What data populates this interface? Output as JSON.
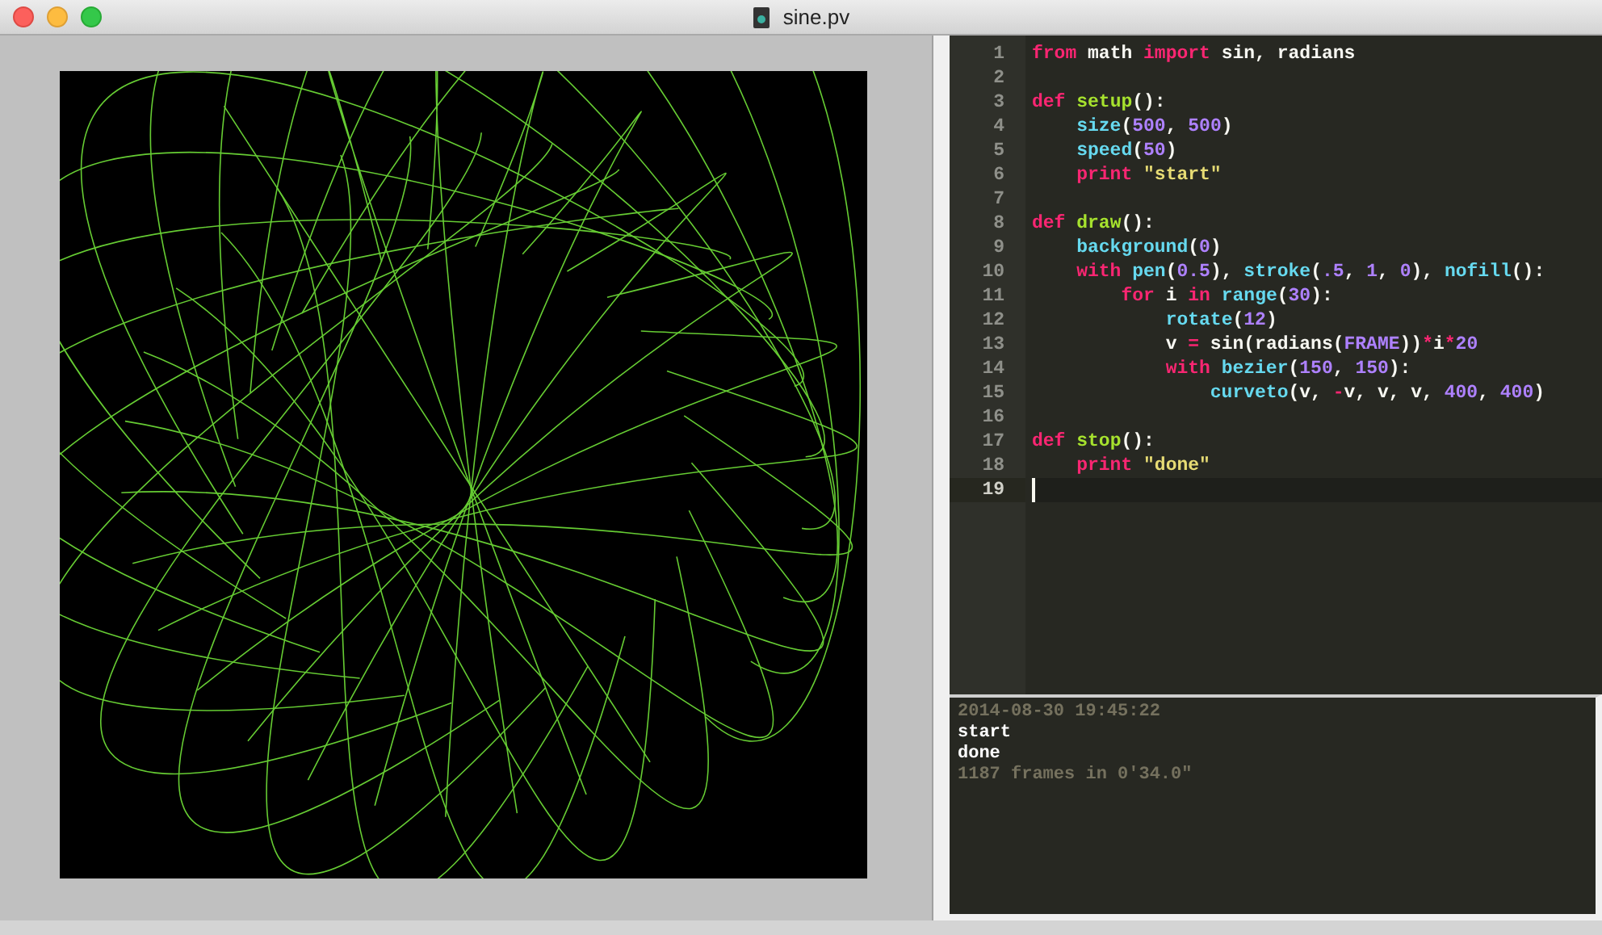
{
  "window": {
    "title": "sine.pv"
  },
  "editor": {
    "lines": [
      {
        "number": "1",
        "current": false,
        "tokens": [
          {
            "kind": "keyword",
            "text": "from"
          },
          {
            "kind": "plain",
            "text": " math "
          },
          {
            "kind": "keyword",
            "text": "import"
          },
          {
            "kind": "plain",
            "text": " sin, radians"
          }
        ]
      },
      {
        "number": "2",
        "current": false
      },
      {
        "number": "3",
        "current": false,
        "tokens": [
          {
            "kind": "keyword",
            "text": "def "
          },
          {
            "kind": "definition",
            "text": "setup"
          },
          {
            "kind": "plain",
            "text": "():"
          }
        ],
        "children": [
          {
            "number": "4",
            "current": false,
            "tokens": [
              {
                "kind": "function",
                "text": "size"
              },
              {
                "kind": "plain",
                "text": "("
              },
              {
                "kind": "number",
                "text": "500"
              },
              {
                "kind": "plain",
                "text": ", "
              },
              {
                "kind": "number",
                "text": "500"
              },
              {
                "kind": "plain",
                "text": ")"
              }
            ]
          },
          {
            "number": "5",
            "current": false,
            "tokens": [
              {
                "kind": "function",
                "text": "speed"
              },
              {
                "kind": "plain",
                "text": "("
              },
              {
                "kind": "number",
                "text": "50"
              },
              {
                "kind": "plain",
                "text": ")"
              }
            ]
          },
          {
            "number": "6",
            "current": false,
            "tokens": [
              {
                "kind": "keyword",
                "text": "print "
              },
              {
                "kind": "string",
                "text": "\"start\""
              }
            ]
          }
        ]
      },
      {
        "number": "7",
        "current": false
      },
      {
        "number": "8",
        "current": false,
        "tokens": [
          {
            "kind": "keyword",
            "text": "def "
          },
          {
            "kind": "definition",
            "text": "draw"
          },
          {
            "kind": "plain",
            "text": "():"
          }
        ],
        "children": [
          {
            "number": "9",
            "current": false,
            "tokens": [
              {
                "kind": "function",
                "text": "background"
              },
              {
                "kind": "plain",
                "text": "("
              },
              {
                "kind": "number",
                "text": "0"
              },
              {
                "kind": "plain",
                "text": ")"
              }
            ]
          },
          {
            "number": "10",
            "current": false,
            "tokens": [
              {
                "kind": "keyword",
                "text": "with "
              },
              {
                "kind": "function",
                "text": "pen"
              },
              {
                "kind": "plain",
                "text": "("
              },
              {
                "kind": "number",
                "text": "0.5"
              },
              {
                "kind": "plain",
                "text": "), "
              },
              {
                "kind": "function",
                "text": "stroke"
              },
              {
                "kind": "plain",
                "text": "("
              },
              {
                "kind": "number",
                "text": ".5"
              },
              {
                "kind": "plain",
                "text": ", "
              },
              {
                "kind": "number",
                "text": "1"
              },
              {
                "kind": "plain",
                "text": ", "
              },
              {
                "kind": "number",
                "text": "0"
              },
              {
                "kind": "plain",
                "text": "), "
              },
              {
                "kind": "function",
                "text": "nofill"
              },
              {
                "kind": "plain",
                "text": "():"
              }
            ],
            "children": [
              {
                "number": "11",
                "current": false,
                "tokens": [
                  {
                    "kind": "keyword",
                    "text": "for"
                  },
                  {
                    "kind": "plain",
                    "text": " i "
                  },
                  {
                    "kind": "keyword",
                    "text": "in "
                  },
                  {
                    "kind": "function",
                    "text": "range"
                  },
                  {
                    "kind": "plain",
                    "text": "("
                  },
                  {
                    "kind": "number",
                    "text": "30"
                  },
                  {
                    "kind": "plain",
                    "text": "):"
                  }
                ],
                "children": [
                  {
                    "number": "12",
                    "current": false,
                    "tokens": [
                      {
                        "kind": "function",
                        "text": "rotate"
                      },
                      {
                        "kind": "plain",
                        "text": "("
                      },
                      {
                        "kind": "number",
                        "text": "12"
                      },
                      {
                        "kind": "plain",
                        "text": ")"
                      }
                    ]
                  },
                  {
                    "number": "13",
                    "current": false,
                    "tokens": [
                      {
                        "kind": "plain",
                        "text": "v "
                      },
                      {
                        "kind": "keyword",
                        "text": "="
                      },
                      {
                        "kind": "plain",
                        "text": " sin(radians("
                      },
                      {
                        "kind": "number",
                        "text": "FRAME"
                      },
                      {
                        "kind": "plain",
                        "text": "))"
                      },
                      {
                        "kind": "keyword",
                        "text": "*"
                      },
                      {
                        "kind": "plain",
                        "text": "i"
                      },
                      {
                        "kind": "keyword",
                        "text": "*"
                      },
                      {
                        "kind": "number",
                        "text": "20"
                      }
                    ]
                  },
                  {
                    "number": "14",
                    "current": false,
                    "tokens": [
                      {
                        "kind": "keyword",
                        "text": "with "
                      },
                      {
                        "kind": "function",
                        "text": "bezier"
                      },
                      {
                        "kind": "plain",
                        "text": "("
                      },
                      {
                        "kind": "number",
                        "text": "150"
                      },
                      {
                        "kind": "plain",
                        "text": ", "
                      },
                      {
                        "kind": "number",
                        "text": "150"
                      },
                      {
                        "kind": "plain",
                        "text": "):"
                      }
                    ],
                    "children": [
                      {
                        "number": "15",
                        "current": false,
                        "tokens": [
                          {
                            "kind": "function",
                            "text": "curveto"
                          },
                          {
                            "kind": "plain",
                            "text": "(v, "
                          },
                          {
                            "kind": "keyword",
                            "text": "-"
                          },
                          {
                            "kind": "plain",
                            "text": "v, v, v, "
                          },
                          {
                            "kind": "number",
                            "text": "400"
                          },
                          {
                            "kind": "plain",
                            "text": ", "
                          },
                          {
                            "kind": "number",
                            "text": "400"
                          },
                          {
                            "kind": "plain",
                            "text": ")"
                          }
                        ]
                      }
                    ]
                  }
                ]
              }
            ]
          }
        ]
      },
      {
        "number": "16",
        "current": false
      },
      {
        "number": "17",
        "current": false,
        "tokens": [
          {
            "kind": "keyword",
            "text": "def "
          },
          {
            "kind": "definition",
            "text": "stop"
          },
          {
            "kind": "plain",
            "text": "():"
          }
        ],
        "children": [
          {
            "number": "18",
            "current": false,
            "tokens": [
              {
                "kind": "keyword",
                "text": "print "
              },
              {
                "kind": "string",
                "text": "\"done\""
              }
            ]
          }
        ]
      },
      {
        "number": "19",
        "current": true
      }
    ]
  },
  "console": {
    "lines": [
      {
        "kind": "meta",
        "text": "2014-08-30 19:45:22"
      },
      {
        "kind": "output",
        "text": "start"
      },
      {
        "kind": "output",
        "text": "done"
      },
      {
        "kind": "meta",
        "text": "1187 frames in 0'34.0\""
      }
    ]
  }
}
